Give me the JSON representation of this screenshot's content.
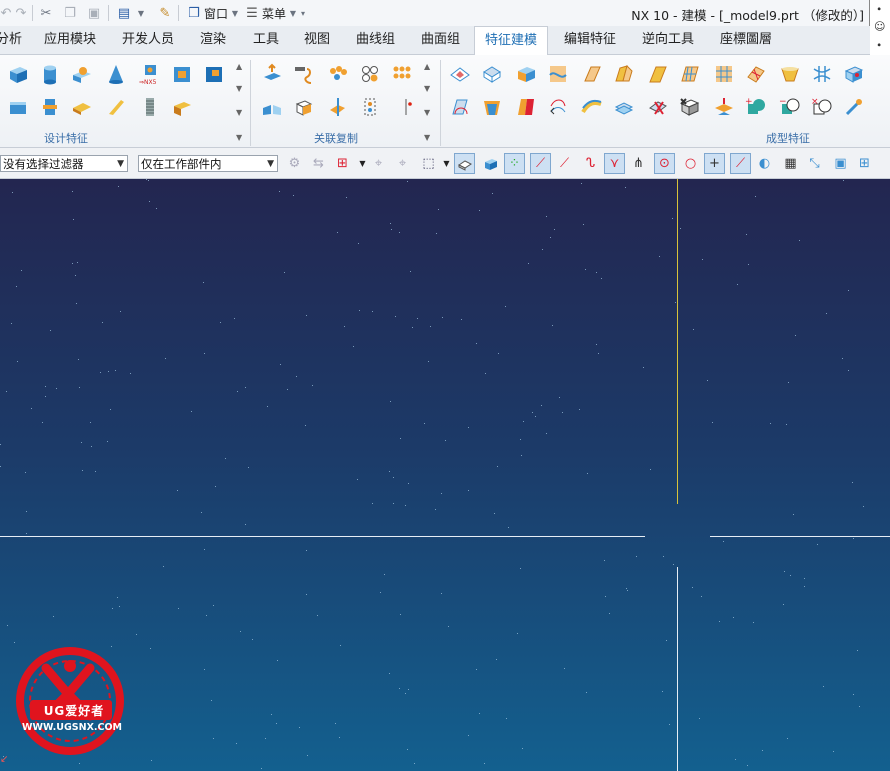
{
  "window": {
    "title": "NX 10 - 建模 - [_model9.prt （修改的）]",
    "window_menu_label": "窗口",
    "menu_label": "菜单"
  },
  "tabs": [
    {
      "label": "分析",
      "active": false
    },
    {
      "label": "应用模块",
      "active": false
    },
    {
      "label": "开发人员",
      "active": false
    },
    {
      "label": "渲染",
      "active": false
    },
    {
      "label": "工具",
      "active": false
    },
    {
      "label": "视图",
      "active": false
    },
    {
      "label": "曲线组",
      "active": false
    },
    {
      "label": "曲面组",
      "active": false
    },
    {
      "label": "特征建模",
      "active": true
    },
    {
      "label": "编辑特征",
      "active": false
    },
    {
      "label": "逆向工具",
      "active": false
    },
    {
      "label": "座標圖層",
      "active": false
    }
  ],
  "ribbon_groups": {
    "design_features": "设计特征",
    "associative_copy": "关联复制",
    "forming_features": "成型特征"
  },
  "selection_bar": {
    "filter_value": "没有选择过滤器",
    "scope_value": "仅在工作部件内"
  },
  "logo": {
    "brand": "UG爱好者",
    "url": "WWW.UGSNX.COM"
  },
  "colors": {
    "accent": "#1f6fb4",
    "viewport_top": "#232650",
    "viewport_bottom": "#13608f",
    "logo_red": "#e0141e"
  }
}
